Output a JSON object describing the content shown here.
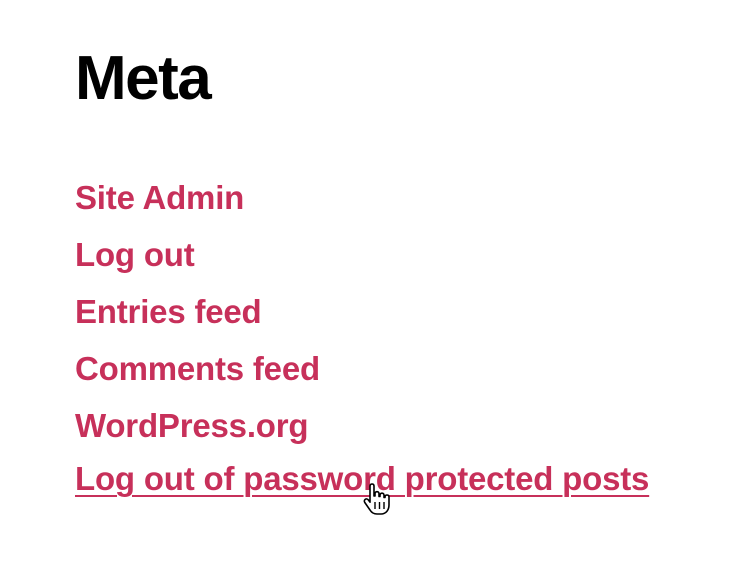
{
  "widget": {
    "title": "Meta",
    "links": [
      {
        "label": "Site Admin"
      },
      {
        "label": "Log out"
      },
      {
        "label": "Entries feed"
      },
      {
        "label": "Comments feed"
      },
      {
        "label": "WordPress.org"
      },
      {
        "label": "Log out of password protected posts",
        "hovered": true
      }
    ]
  },
  "colors": {
    "link": "#c7305a",
    "title": "#000000",
    "background": "#ffffff"
  },
  "cursor": {
    "icon": "hand-pointer-icon"
  }
}
